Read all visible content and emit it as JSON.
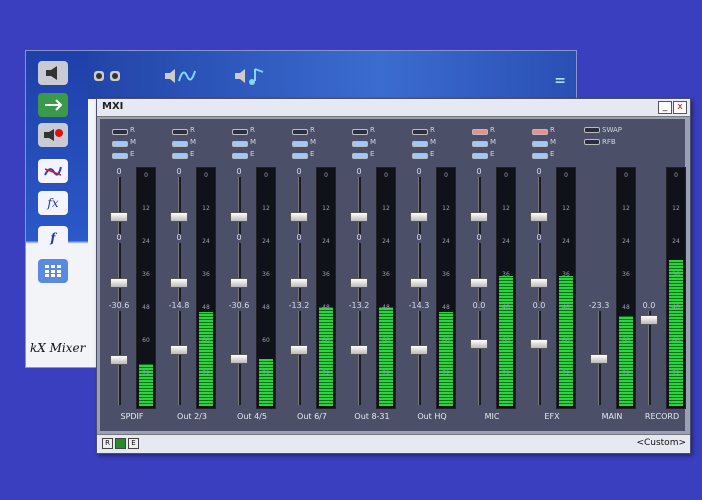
{
  "back_window": {
    "caption": "kX Mixer",
    "side_icons": [
      "speaker-icon",
      "routing-icon",
      "record-icon",
      "graph-icon",
      "fx-icon",
      "f-icon",
      "grid-icon"
    ],
    "top_icons": [
      "speakers-icon",
      "wave-icon",
      "note-icon"
    ],
    "top_right_glyph": "="
  },
  "mixer_window": {
    "title": "MXI",
    "minimize_label": "_",
    "close_label": "x",
    "status_buttons": [
      "R",
      "",
      "E"
    ],
    "preset_label": "<Custom>"
  },
  "flag_labels": [
    "R",
    "M",
    "E"
  ],
  "meter_ticks": [
    "0",
    "12",
    "24",
    "36",
    "48",
    "60",
    "72"
  ],
  "strips": [
    {
      "label": "SPDIF",
      "v1": "0",
      "v2": "0",
      "v3": "-30.6",
      "level": 0.18,
      "r_on": false
    },
    {
      "label": "Out 2/3",
      "v1": "0",
      "v2": "0",
      "v3": "-14.8",
      "level": 0.4,
      "r_on": false
    },
    {
      "label": "Out 4/5",
      "v1": "0",
      "v2": "0",
      "v3": "-30.6",
      "level": 0.2,
      "r_on": false
    },
    {
      "label": "Out 6/7",
      "v1": "0",
      "v2": "0",
      "v3": "-13.2",
      "level": 0.42,
      "r_on": false
    },
    {
      "label": "Out 8-31",
      "v1": "0",
      "v2": "0",
      "v3": "-13.2",
      "level": 0.42,
      "r_on": false
    },
    {
      "label": "Out HQ",
      "v1": "0",
      "v2": "0",
      "v3": "-14.3",
      "level": 0.4,
      "r_on": false
    },
    {
      "label": "MIC",
      "v1": "0",
      "v2": "0",
      "v3": "0.0",
      "level": 0.55,
      "r_on": true
    },
    {
      "label": "EFX",
      "v1": "0",
      "v2": "0",
      "v3": "0.0",
      "level": 0.55,
      "r_on": true
    }
  ],
  "main": {
    "label": "MAIN",
    "value": "-23.3",
    "level": 0.38,
    "swap_label": "SWAP",
    "rfb_label": "RFB"
  },
  "record": {
    "label": "RECORD",
    "value": "0.0",
    "level": 0.62
  }
}
